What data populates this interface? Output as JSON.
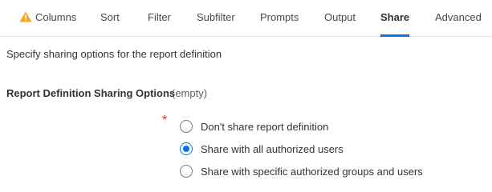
{
  "tabs": [
    {
      "label": "Columns",
      "warning": true
    },
    {
      "label": "Sort"
    },
    {
      "label": "Filter"
    },
    {
      "label": "Subfilter"
    },
    {
      "label": "Prompts"
    },
    {
      "label": "Output"
    },
    {
      "label": "Share",
      "active": true
    },
    {
      "label": "Advanced"
    }
  ],
  "description": "Specify sharing options for the report definition",
  "sharing": {
    "label": "Report Definition Sharing Options",
    "value": "(empty)",
    "required_marker": "*",
    "options": [
      {
        "label": "Don't share report definition",
        "selected": false
      },
      {
        "label": "Share with all authorized users",
        "selected": true
      },
      {
        "label": "Share with specific authorized groups and users",
        "selected": false
      }
    ]
  },
  "colors": {
    "accent": "#0875e1",
    "warning": "#f5a623",
    "required": "#de2f2f"
  },
  "icons": {
    "warning": "warning-icon"
  }
}
